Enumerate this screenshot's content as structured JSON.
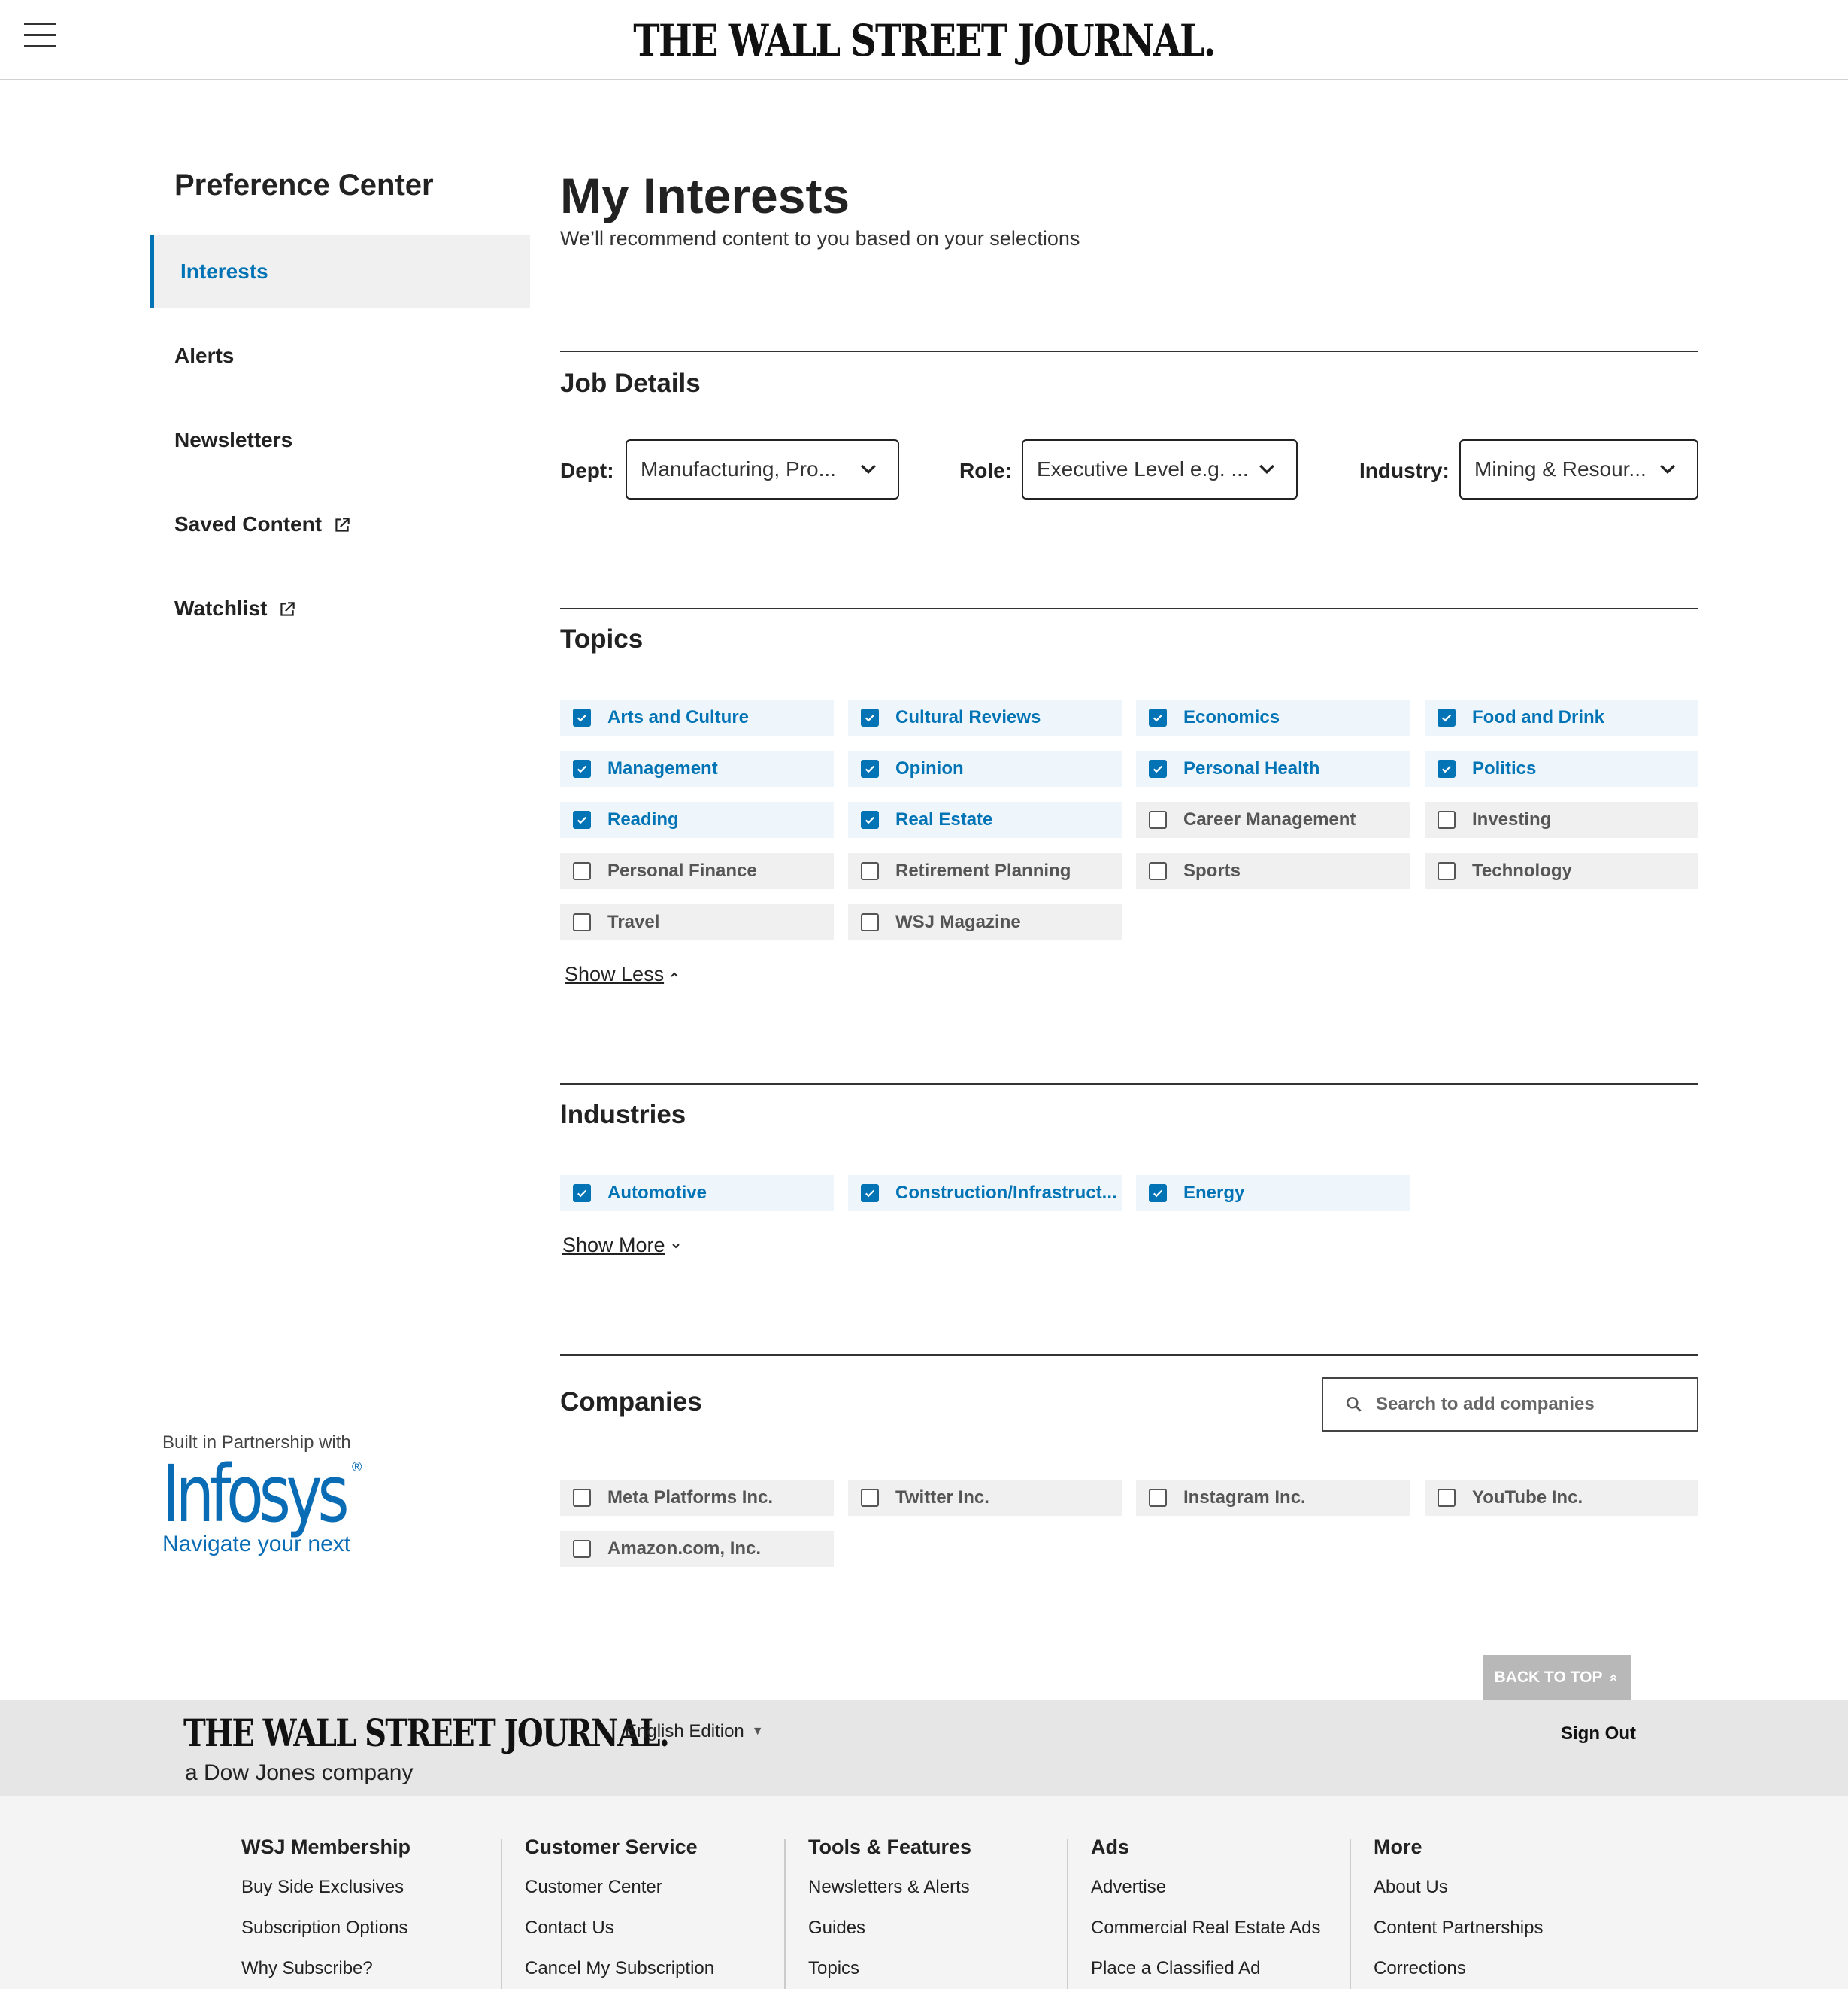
{
  "header": {
    "masthead": "THE WALL STREET JOURNAL."
  },
  "sidebar": {
    "title": "Preference Center",
    "items": [
      {
        "label": "Interests",
        "active": true,
        "external": false
      },
      {
        "label": "Alerts",
        "active": false,
        "external": false
      },
      {
        "label": "Newsletters",
        "active": false,
        "external": false
      },
      {
        "label": "Saved Content",
        "active": false,
        "external": true
      },
      {
        "label": "Watchlist",
        "active": false,
        "external": true
      }
    ],
    "partner": {
      "label": "Built in Partnership with",
      "logo": "Infosys",
      "reg": "®",
      "tagline": "Navigate your next"
    }
  },
  "main": {
    "title": "My Interests",
    "subtitle": "We’ll recommend content to you based on your selections",
    "job_details": {
      "title": "Job Details",
      "dept": {
        "label": "Dept:",
        "value": "Manufacturing, Pro..."
      },
      "role": {
        "label": "Role:",
        "value": "Executive Level e.g. ..."
      },
      "industry": {
        "label": "Industry:",
        "value": "Mining & Resour..."
      }
    },
    "topics": {
      "title": "Topics",
      "items": [
        {
          "label": "Arts and Culture",
          "checked": true
        },
        {
          "label": "Cultural Reviews",
          "checked": true
        },
        {
          "label": "Economics",
          "checked": true
        },
        {
          "label": "Food and Drink",
          "checked": true
        },
        {
          "label": "Management",
          "checked": true
        },
        {
          "label": "Opinion",
          "checked": true
        },
        {
          "label": "Personal Health",
          "checked": true
        },
        {
          "label": "Politics",
          "checked": true
        },
        {
          "label": "Reading",
          "checked": true
        },
        {
          "label": "Real Estate",
          "checked": true
        },
        {
          "label": "Career Management",
          "checked": false
        },
        {
          "label": "Investing",
          "checked": false
        },
        {
          "label": "Personal Finance",
          "checked": false
        },
        {
          "label": "Retirement Planning",
          "checked": false
        },
        {
          "label": "Sports",
          "checked": false
        },
        {
          "label": "Technology",
          "checked": false
        },
        {
          "label": "Travel",
          "checked": false
        },
        {
          "label": "WSJ Magazine",
          "checked": false
        }
      ],
      "toggle_label": "Show Less"
    },
    "industries": {
      "title": "Industries",
      "items": [
        {
          "label": "Automotive",
          "checked": true
        },
        {
          "label": "Construction/Infrastruct...",
          "checked": true
        },
        {
          "label": "Energy",
          "checked": true
        }
      ],
      "toggle_label": "Show More"
    },
    "companies": {
      "title": "Companies",
      "search_placeholder": "Search to add companies",
      "items": [
        {
          "label": "Meta Platforms Inc.",
          "checked": false
        },
        {
          "label": "Twitter Inc.",
          "checked": false
        },
        {
          "label": "Instagram Inc.",
          "checked": false
        },
        {
          "label": "YouTube Inc.",
          "checked": false
        },
        {
          "label": "Amazon.com, Inc.",
          "checked": false
        }
      ]
    }
  },
  "back_to_top": "BACK TO TOP",
  "footer": {
    "masthead": "THE WALL STREET JOURNAL.",
    "company": "a Dow Jones company",
    "edition": "English Edition",
    "sign_out": "Sign Out",
    "columns": [
      {
        "title": "WSJ Membership",
        "links": [
          "Buy Side Exclusives",
          "Subscription Options",
          "Why Subscribe?"
        ]
      },
      {
        "title": "Customer Service",
        "links": [
          "Customer Center",
          "Contact Us",
          "Cancel My Subscription"
        ]
      },
      {
        "title": "Tools & Features",
        "links": [
          "Newsletters & Alerts",
          "Guides",
          "Topics"
        ]
      },
      {
        "title": "Ads",
        "links": [
          "Advertise",
          "Commercial Real Estate Ads",
          "Place a Classified Ad"
        ]
      },
      {
        "title": "More",
        "links": [
          "About Us",
          "Content Partnerships",
          "Corrections"
        ]
      }
    ]
  },
  "colors": {
    "accent": "#0274b6",
    "checked_bg": "#eef6fc",
    "unchecked_bg": "#f0f0f0",
    "footer_band": "#e6e6e6",
    "footer_links_bg": "#f4f4f4"
  }
}
